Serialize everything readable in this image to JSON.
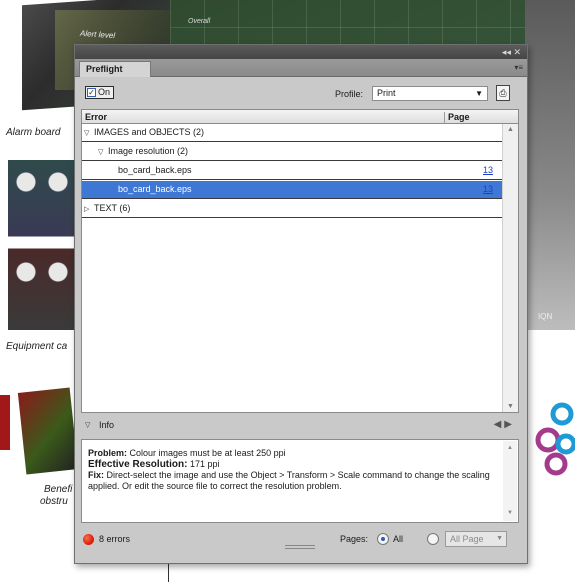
{
  "background": {
    "top_label_1": "Alert level",
    "top_label_2": "Overall",
    "caption_1": "Alarm board",
    "caption_2": "Equipment ca",
    "caption_3a": "Benefi",
    "caption_3b": "obstru",
    "map_corner": "IQN"
  },
  "panel": {
    "titlebar_controls": "◂◂  ✕",
    "tab_label": "Preflight",
    "menu_icon": "▾≡",
    "on_label": "On",
    "on_checked": true,
    "profile_label": "Profile:",
    "profile_value": "Print",
    "columns": {
      "error": "Error",
      "page": "Page"
    },
    "rows": [
      {
        "indent": 2,
        "expanded": true,
        "label": "IMAGES and OBJECTS (2)",
        "page": "",
        "selected": false
      },
      {
        "indent": 16,
        "expanded": true,
        "label": "Image resolution (2)",
        "page": "",
        "selected": false
      },
      {
        "indent": 36,
        "expanded": null,
        "label": "bo_card_back.eps",
        "page": "13",
        "selected": false
      },
      {
        "indent": 36,
        "expanded": null,
        "label": "bo_card_back.eps",
        "page": "13",
        "selected": true
      },
      {
        "indent": 2,
        "expanded": false,
        "label": "TEXT (6)",
        "page": "",
        "selected": false
      }
    ],
    "info": {
      "label": "Info",
      "problem_key": "Problem:",
      "problem_text": "Colour images must be at least 250 ppi",
      "resolution_key": "Effective Resolution:",
      "resolution_text": "171 ppi",
      "fix_key": "Fix:",
      "fix_text": "Direct-select the image and use the Object > Transform > Scale command to change the scaling applied. Or edit the source file to correct the resolution problem."
    },
    "footer": {
      "errors": "8 errors",
      "pages_label": "Pages:",
      "all_label": "All",
      "range_placeholder": "All Page",
      "pages_mode": "all"
    },
    "colors": {
      "selection": "#3e78d4",
      "error_dot": "#d8230d",
      "link": "#1d3fcc"
    }
  }
}
